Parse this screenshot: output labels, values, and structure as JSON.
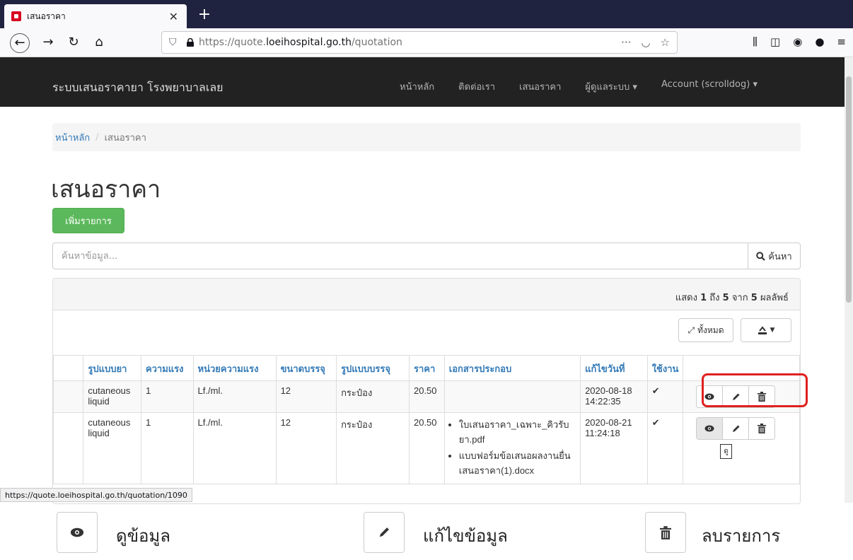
{
  "browser": {
    "tab_title": "เสนอราคา",
    "url_prefix": "https://quote.",
    "url_host": "loeihospital.go.th",
    "url_path": "/quotation",
    "status_url": "https://quote.loeihospital.go.th/quotation/1090"
  },
  "site": {
    "brand": "ระบบเสนอราคายา โรงพยาบาลเลย",
    "nav": [
      "หน้าหลัก",
      "ติดต่อเรา",
      "เสนอราคา",
      "ผู้ดูแลระบบ ▾",
      "Account (scrolldog) ▾"
    ]
  },
  "breadcrumb": {
    "home": "หน้าหลัก",
    "separator": "/",
    "current": "เสนอราคา"
  },
  "page": {
    "title": "เสนอราคา",
    "add_button": "เพิ่มรายการ",
    "search_placeholder": "ค้นหาข้อมูล...",
    "search_button": "ค้นหา"
  },
  "grid": {
    "summary_prefix": "แสดง",
    "summary_from": "1",
    "summary_to_word": "ถึง",
    "summary_to": "5",
    "summary_of_word": "จาก",
    "summary_total": "5",
    "summary_suffix": "ผลลัพธ์",
    "show_all_button": "ทั้งหมด",
    "columns": [
      "",
      "รูปแบบยา",
      "ความแรง",
      "หน่วยความแรง",
      "ขนาดบรรจุ",
      "รูปแบบบรรจุ",
      "ราคา",
      "เอกสารประกอบ",
      "แก้ไขวันที่",
      "ใช้งาน",
      ""
    ],
    "rows": [
      {
        "form": "cutaneous liquid",
        "strength": "1",
        "unit": "Lf./ml.",
        "pack_size": "12",
        "pack_form": "กระป๋อง",
        "price": "20.50",
        "docs": [],
        "updated_date": "2020-08-18",
        "updated_time": "14:22:35",
        "active": "✔"
      },
      {
        "form": "cutaneous liquid",
        "strength": "1",
        "unit": "Lf./ml.",
        "pack_size": "12",
        "pack_form": "กระป๋อง",
        "price": "20.50",
        "docs": [
          "ใบเสนอราคา_เฉพาะ_คิวรับยา.pdf",
          "แบบฟอร์มข้อเสนอผลงานยื่นเสนอราคา(1).docx"
        ],
        "updated_date": "2020-08-21",
        "updated_time": "11:24:18",
        "active": "✔",
        "tooltip": "ดู"
      }
    ]
  },
  "legend": {
    "view": "ดูข้อมูล",
    "edit": "แก้ไขข้อมูล",
    "delete": "ลบรายการ"
  },
  "colors": {
    "navbar": "#222222",
    "primary": "#337ab7",
    "success": "#5cb85c",
    "highlight": "#e02020"
  }
}
